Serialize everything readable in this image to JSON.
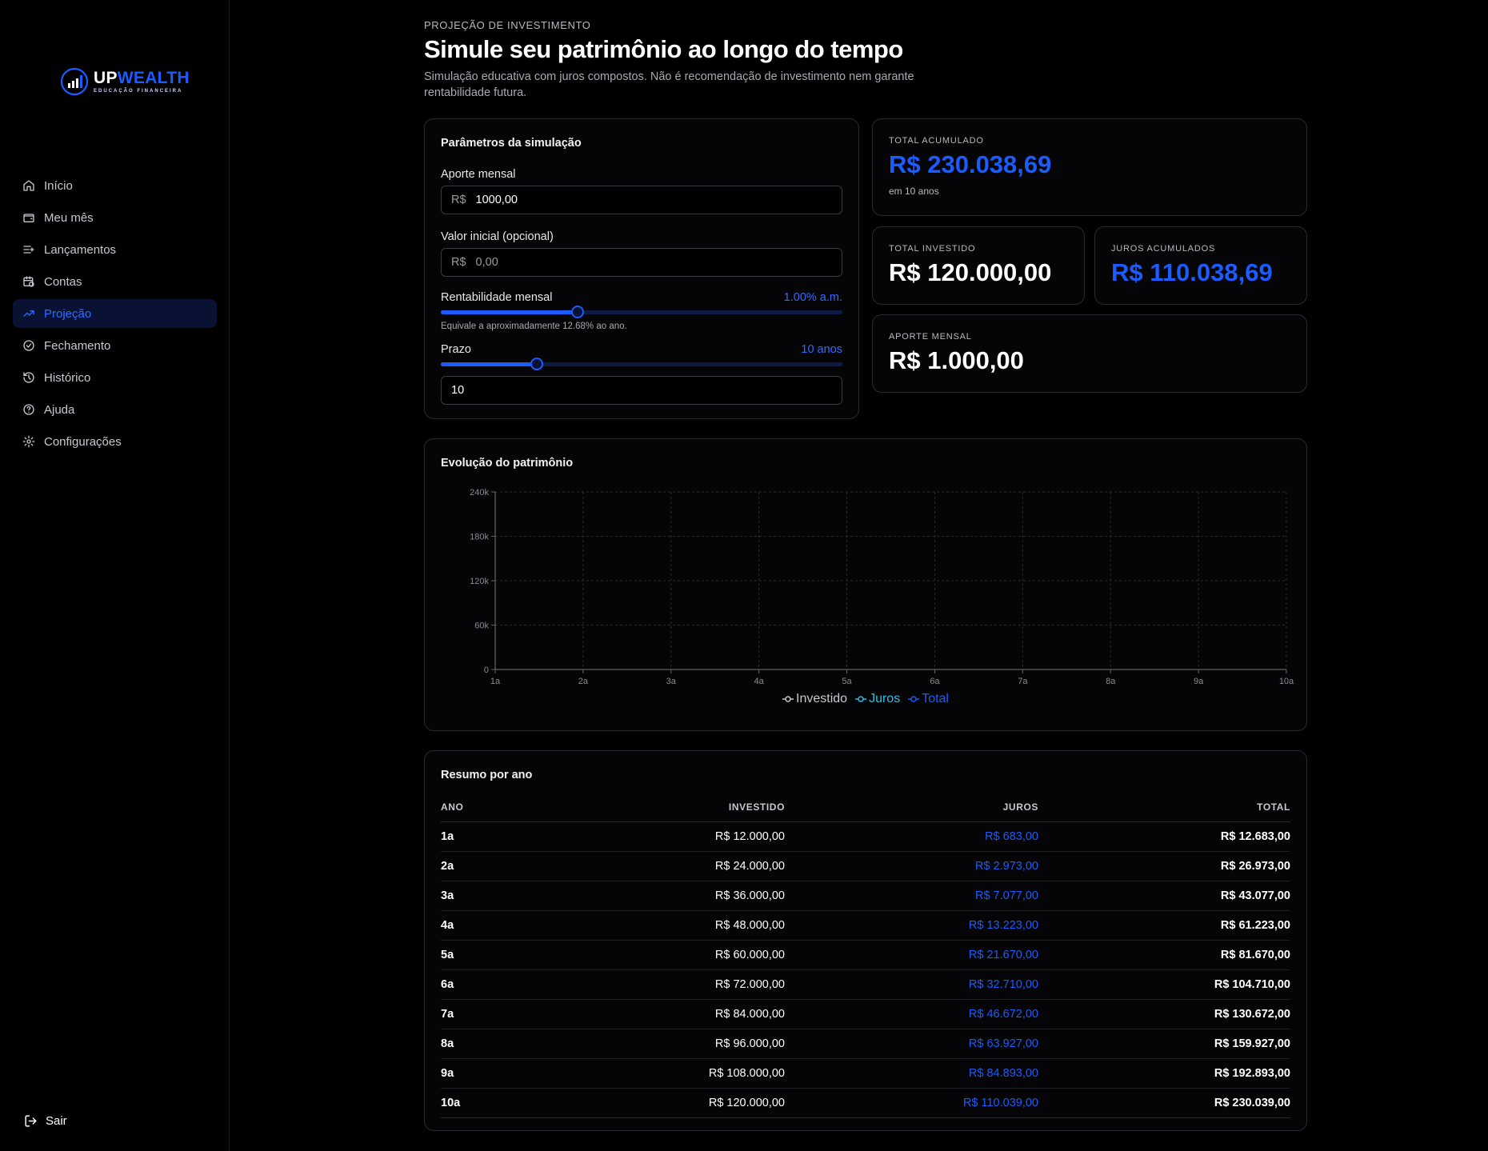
{
  "brand": {
    "name_up": "UP",
    "name_wealth": "WEALTH",
    "tagline": "EDUCAÇÃO FINANCEIRA"
  },
  "sidebar": {
    "items": [
      {
        "label": "Início",
        "icon": "home-icon",
        "active": false
      },
      {
        "label": "Meu mês",
        "icon": "wallet-icon",
        "active": false
      },
      {
        "label": "Lançamentos",
        "icon": "list-plus-icon",
        "active": false
      },
      {
        "label": "Contas",
        "icon": "calendar-clock-icon",
        "active": false
      },
      {
        "label": "Projeção",
        "icon": "trending-up-icon",
        "active": true
      },
      {
        "label": "Fechamento",
        "icon": "check-circle-icon",
        "active": false
      },
      {
        "label": "Histórico",
        "icon": "history-icon",
        "active": false
      },
      {
        "label": "Ajuda",
        "icon": "help-circle-icon",
        "active": false
      },
      {
        "label": "Configurações",
        "icon": "gear-icon",
        "active": false
      }
    ],
    "logout": "Sair"
  },
  "header": {
    "eyebrow": "PROJEÇÃO DE INVESTIMENTO",
    "title": "Simule seu patrimônio ao longo do tempo",
    "subtitle": "Simulação educativa com juros compostos. Não é recomendação de investimento nem garante rentabilidade futura."
  },
  "params": {
    "title": "Parâmetros da simulação",
    "aporte_label": "Aporte mensal",
    "currency": "R$",
    "aporte_value": "1000,00",
    "inicial_label": "Valor inicial (opcional)",
    "inicial_placeholder": "0,00",
    "rent_label": "Rentabilidade mensal",
    "rent_display": "1.00% a.m.",
    "rent_fill_fraction": 0.34,
    "rent_hint": "Equivale a aproximadamente 12.68% ao ano.",
    "prazo_label": "Prazo",
    "prazo_display": "10 anos",
    "prazo_fill_fraction": 0.24,
    "prazo_value": "10"
  },
  "stats": {
    "total_acumulado": {
      "label": "TOTAL ACUMULADO",
      "value": "R$ 230.038,69",
      "note": "em 10 anos"
    },
    "total_investido": {
      "label": "TOTAL INVESTIDO",
      "value": "R$ 120.000,00"
    },
    "juros_acumulados": {
      "label": "JUROS ACUMULADOS",
      "value": "R$ 110.038,69"
    },
    "aporte_mensal": {
      "label": "APORTE MENSAL",
      "value": "R$ 1.000,00"
    }
  },
  "chart_title": "Evolução do patrimônio",
  "chart_data": {
    "type": "line",
    "categories": [
      "1a",
      "2a",
      "3a",
      "4a",
      "5a",
      "6a",
      "7a",
      "8a",
      "9a",
      "10a"
    ],
    "y_ticks": [
      "0",
      "60k",
      "120k",
      "180k",
      "240k"
    ],
    "ylim": [
      0,
      240000
    ],
    "grid": true,
    "legend_position": "bottom-center",
    "series": [
      {
        "name": "Investido",
        "color": "#c8c8d0",
        "values": []
      },
      {
        "name": "Juros",
        "color": "#22c3e6",
        "values": []
      },
      {
        "name": "Total",
        "color": "#1a5cff",
        "values": []
      }
    ]
  },
  "table": {
    "title": "Resumo por ano",
    "headers": {
      "ano": "ANO",
      "investido": "INVESTIDO",
      "juros": "JUROS",
      "total": "TOTAL"
    },
    "rows": [
      {
        "ano": "1a",
        "investido": "R$ 12.000,00",
        "juros": "R$ 683,00",
        "total": "R$ 12.683,00"
      },
      {
        "ano": "2a",
        "investido": "R$ 24.000,00",
        "juros": "R$ 2.973,00",
        "total": "R$ 26.973,00"
      },
      {
        "ano": "3a",
        "investido": "R$ 36.000,00",
        "juros": "R$ 7.077,00",
        "total": "R$ 43.077,00"
      },
      {
        "ano": "4a",
        "investido": "R$ 48.000,00",
        "juros": "R$ 13.223,00",
        "total": "R$ 61.223,00"
      },
      {
        "ano": "5a",
        "investido": "R$ 60.000,00",
        "juros": "R$ 21.670,00",
        "total": "R$ 81.670,00"
      },
      {
        "ano": "6a",
        "investido": "R$ 72.000,00",
        "juros": "R$ 32.710,00",
        "total": "R$ 104.710,00"
      },
      {
        "ano": "7a",
        "investido": "R$ 84.000,00",
        "juros": "R$ 46.672,00",
        "total": "R$ 130.672,00"
      },
      {
        "ano": "8a",
        "investido": "R$ 96.000,00",
        "juros": "R$ 63.927,00",
        "total": "R$ 159.927,00"
      },
      {
        "ano": "9a",
        "investido": "R$ 108.000,00",
        "juros": "R$ 84.893,00",
        "total": "R$ 192.893,00"
      },
      {
        "ano": "10a",
        "investido": "R$ 120.000,00",
        "juros": "R$ 110.039,00",
        "total": "R$ 230.039,00"
      }
    ]
  }
}
